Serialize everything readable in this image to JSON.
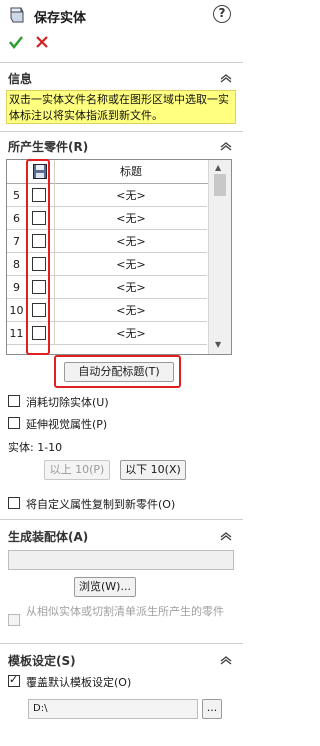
{
  "header": {
    "title": "保存实体",
    "help_label": "?",
    "ok_icon": "green-check-icon",
    "cancel_icon": "red-x-icon"
  },
  "info": {
    "title": "信息",
    "text": "双击一实体文件名称或在图形区域中选取一实体标注以将实体指派到新文件。"
  },
  "parts": {
    "title": "所产生零件(R)",
    "table": {
      "header_title": "标题",
      "rows": [
        {
          "num": "5",
          "value": "<无>"
        },
        {
          "num": "6",
          "value": "<无>"
        },
        {
          "num": "7",
          "value": "<无>"
        },
        {
          "num": "8",
          "value": "<无>"
        },
        {
          "num": "9",
          "value": "<无>"
        },
        {
          "num": "10",
          "value": "<无>"
        },
        {
          "num": "11",
          "value": "<无>"
        }
      ]
    },
    "auto_assign_label": "自动分配标题(T)",
    "consume_cut_label": "消耗切除实体(U)",
    "extend_visual_label": "延伸视觉属性(P)",
    "bodies_label": "实体: 1-10",
    "prev_label": "以上 10(P)",
    "next_label": "以下 10(X)",
    "copy_custom_label": "将自定义属性复制到新零件(O)"
  },
  "assembly": {
    "title": "生成装配体(A)",
    "path_value": "",
    "browse_label": "浏览(W)...",
    "derive_label": "从相似实体或切割清单派生所产生的零件"
  },
  "template": {
    "title": "模板设定(S)",
    "override_label": "覆盖默认模板设定(O)",
    "override_checked": true,
    "path_value": "D:\\",
    "browse_small_label": "..."
  },
  "colors": {
    "highlight_frame": "#e02020",
    "info_background": "#ffff80",
    "ok_green": "#2e9e2e",
    "cancel_red": "#d42020"
  }
}
